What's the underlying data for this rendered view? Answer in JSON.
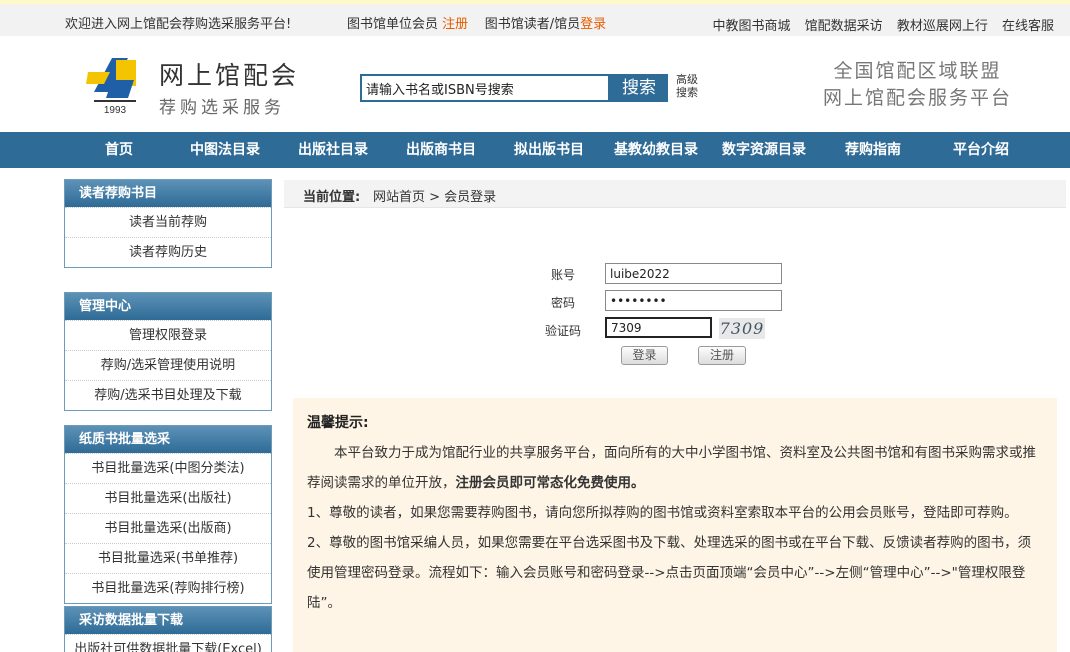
{
  "topbar": {
    "welcome": "欢迎进入网上馆配会荐购选采服务平台!",
    "member_text": "图书馆单位会员",
    "register": "注册",
    "reader_text": "图书馆读者/馆员",
    "login": "登录",
    "links": [
      "中教图书商城",
      "馆配数据采访",
      "教材巡展网上行",
      "在线客服"
    ]
  },
  "header": {
    "logo_year": "1993",
    "site_name": "网上馆配会",
    "site_sub": "荐购选采服务",
    "search_placeholder": "请输入书名或ISBN号搜索",
    "search_btn": "搜索",
    "advanced": "高级搜索",
    "slogan_line1": "全国馆配区域联盟",
    "slogan_line2": "网上馆配会服务平台"
  },
  "nav": [
    "首页",
    "中图法目录",
    "出版社目录",
    "出版商书目",
    "拟出版书目",
    "基教幼教目录",
    "数字资源目录",
    "荐购指南",
    "平台介绍"
  ],
  "sidebar": [
    {
      "title": "读者荐购书目",
      "items": [
        "读者当前荐购",
        "读者荐购历史"
      ]
    },
    {
      "title": "管理中心",
      "items": [
        "管理权限登录",
        "荐购/选采管理使用说明",
        "荐购/选采书目处理及下载"
      ]
    },
    {
      "title": "纸质书批量选采",
      "items": [
        "书目批量选采(中图分类法)",
        "书目批量选采(出版社)",
        "书目批量选采(出版商)",
        "书目批量选采(书单推荐)",
        "书目批量选采(荐购排行榜)"
      ]
    },
    {
      "title": "采访数据批量下载",
      "items": [
        "出版社可供数据批量下载(Excel)"
      ]
    }
  ],
  "breadcrumb": {
    "label": "当前位置:",
    "path": "网站首页 > 会员登录"
  },
  "login_form": {
    "account_label": "账号",
    "account_value": "luibe2022",
    "password_label": "密码",
    "password_value": "••••••••",
    "captcha_label": "验证码",
    "captcha_value": "7309",
    "captcha_image_text": "7309",
    "login_btn": "登录",
    "register_btn": "注册"
  },
  "notice": {
    "title": "温馨提示:",
    "para1_a": "本平台致力于成为馆配行业的共享服务平台，面向所有的大中小学图书馆、资料室及公共图书馆和有图书采购需求或推荐阅读需求的单位开放，",
    "para1_b": "注册会员即可常态化免费使用。",
    "para2": "1、尊敬的读者，如果您需要荐购图书，请向您所拟荐购的图书馆或资料室索取本平台的公用会员账号，登陆即可荐购。",
    "para3": "2、尊敬的图书馆采编人员，如果您需要在平台选采图书及下载、处理选采的图书或在平台下载、反馈读者荐购的图书，须使用管理密码登录。流程如下：输入会员账号和密码登录-->点击页面顶端“会员中心”-->左侧“管理中心”-->\"管理权限登陆”。"
  },
  "colors": {
    "primary_blue": "#2e6b96",
    "orange": "#e65c00",
    "notice_bg": "#fff5e6"
  }
}
